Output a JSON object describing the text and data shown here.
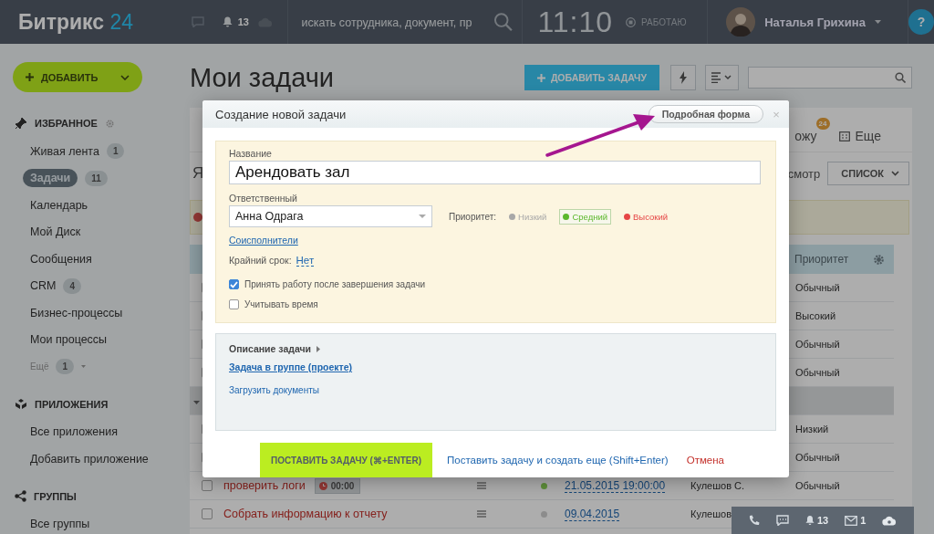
{
  "topbar": {
    "logo": "Битрикс",
    "logo_number": "24",
    "notifications": "13",
    "search": {
      "placeholder": "искать сотрудника, документ, пр"
    },
    "time": "11:10",
    "work_status": "РАБОТАЮ",
    "user": "Наталья Грихина",
    "help": "?"
  },
  "sidebar": {
    "add_button": "ДОБАВИТЬ",
    "sections": [
      {
        "kind": "favorites",
        "title": "ИЗБРАННОЕ",
        "items": [
          {
            "kind": "link",
            "label": "Живая лента",
            "counter": "1",
            "selected": false
          },
          {
            "kind": "link",
            "label": "Задачи",
            "counter": "11",
            "selected": true
          },
          {
            "kind": "link",
            "label": "Календарь",
            "selected": false
          },
          {
            "kind": "link",
            "label": "Мой Диск",
            "selected": false
          },
          {
            "kind": "link",
            "label": "Сообщения",
            "selected": false
          },
          {
            "kind": "link",
            "label": "CRM",
            "counter": "4",
            "selected": false
          },
          {
            "kind": "link",
            "label": "Бизнес-процессы",
            "selected": false
          },
          {
            "kind": "link",
            "label": "Мои процессы",
            "selected": false
          },
          {
            "kind": "more",
            "label": "Ещё",
            "counter": "1",
            "selected": false
          }
        ]
      },
      {
        "kind": "apps",
        "title": "ПРИЛОЖЕНИЯ",
        "items": [
          {
            "kind": "link",
            "label": "Все приложения",
            "selected": false
          },
          {
            "kind": "link",
            "label": "Добавить приложение",
            "selected": false
          }
        ]
      },
      {
        "kind": "groups",
        "title": "ГРУППЫ",
        "items": [
          {
            "kind": "link",
            "label": "Все группы",
            "selected": false
          }
        ]
      }
    ]
  },
  "page": {
    "title": "Мои задачи",
    "add_task_button": "ДОБАВИТЬ ЗАДАЧУ"
  },
  "background": {
    "heading_initial": "Я",
    "filter_tail": "ожу",
    "filter_badge": "24",
    "more": "Еще",
    "view_label": "смотр",
    "view_select": "СПИСОК",
    "priority_header": "Приоритет",
    "rows": [
      {
        "kind": "task",
        "checked": false,
        "priority": "Обычный"
      },
      {
        "kind": "task",
        "checked": false,
        "priority": "Высокий"
      },
      {
        "kind": "task",
        "checked": false,
        "priority": "Обычный"
      },
      {
        "kind": "task",
        "checked": false,
        "priority": "Обычный"
      },
      {
        "kind": "group"
      },
      {
        "kind": "task",
        "checked": false,
        "priority": "Низкий"
      },
      {
        "kind": "task",
        "checked": false,
        "priority": "Обычный"
      },
      {
        "kind": "task",
        "checked": false,
        "title": "проверить логи",
        "timer": "00:00",
        "color": "#5f8f3b",
        "deadline": "21.05.2015 19:00:00",
        "responsible": "Кулешов С.",
        "priority": "Обычный"
      },
      {
        "kind": "task",
        "checked": false,
        "title": "Собрать информацию к отчету",
        "color": "#8c8c8c",
        "deadline": "09.04.2015",
        "responsible": "Кулешов"
      }
    ]
  },
  "modal": {
    "title": "Создание новой задачи",
    "detailed_form_button": "Подробная форма",
    "close": "×",
    "name_label": "Название",
    "name_value": "Арендовать зал",
    "responsible_label": "Ответственный",
    "responsible_value": "Анна Одрага",
    "priority_label": "Приоритет:",
    "priorities": [
      {
        "label": "Низкий",
        "color": "#a8a8a8",
        "selected": false
      },
      {
        "label": "Средний",
        "color": "#5cb82d",
        "selected": true
      },
      {
        "label": "Высокий",
        "color": "#e64545",
        "selected": false
      }
    ],
    "coexecutors": "Соисполнители",
    "deadline_label": "Крайний срок:",
    "deadline_value": "Нет",
    "options": [
      {
        "label": "Принять работу после завершения задачи",
        "checked": true
      },
      {
        "label": "Учитывать время",
        "checked": false
      }
    ],
    "description": "Описание задачи",
    "group_link": "Задача в группе (проекте)",
    "upload": "Загрузить документы",
    "submit": "ПОСТАВИТЬ ЗАДАЧУ (⌘+ENTER)",
    "submit_more": "Поставить задачу и создать еще (Shift+Enter)",
    "cancel": "Отмена"
  },
  "bottom_bar": {
    "notifications": "13",
    "messages": "1"
  }
}
